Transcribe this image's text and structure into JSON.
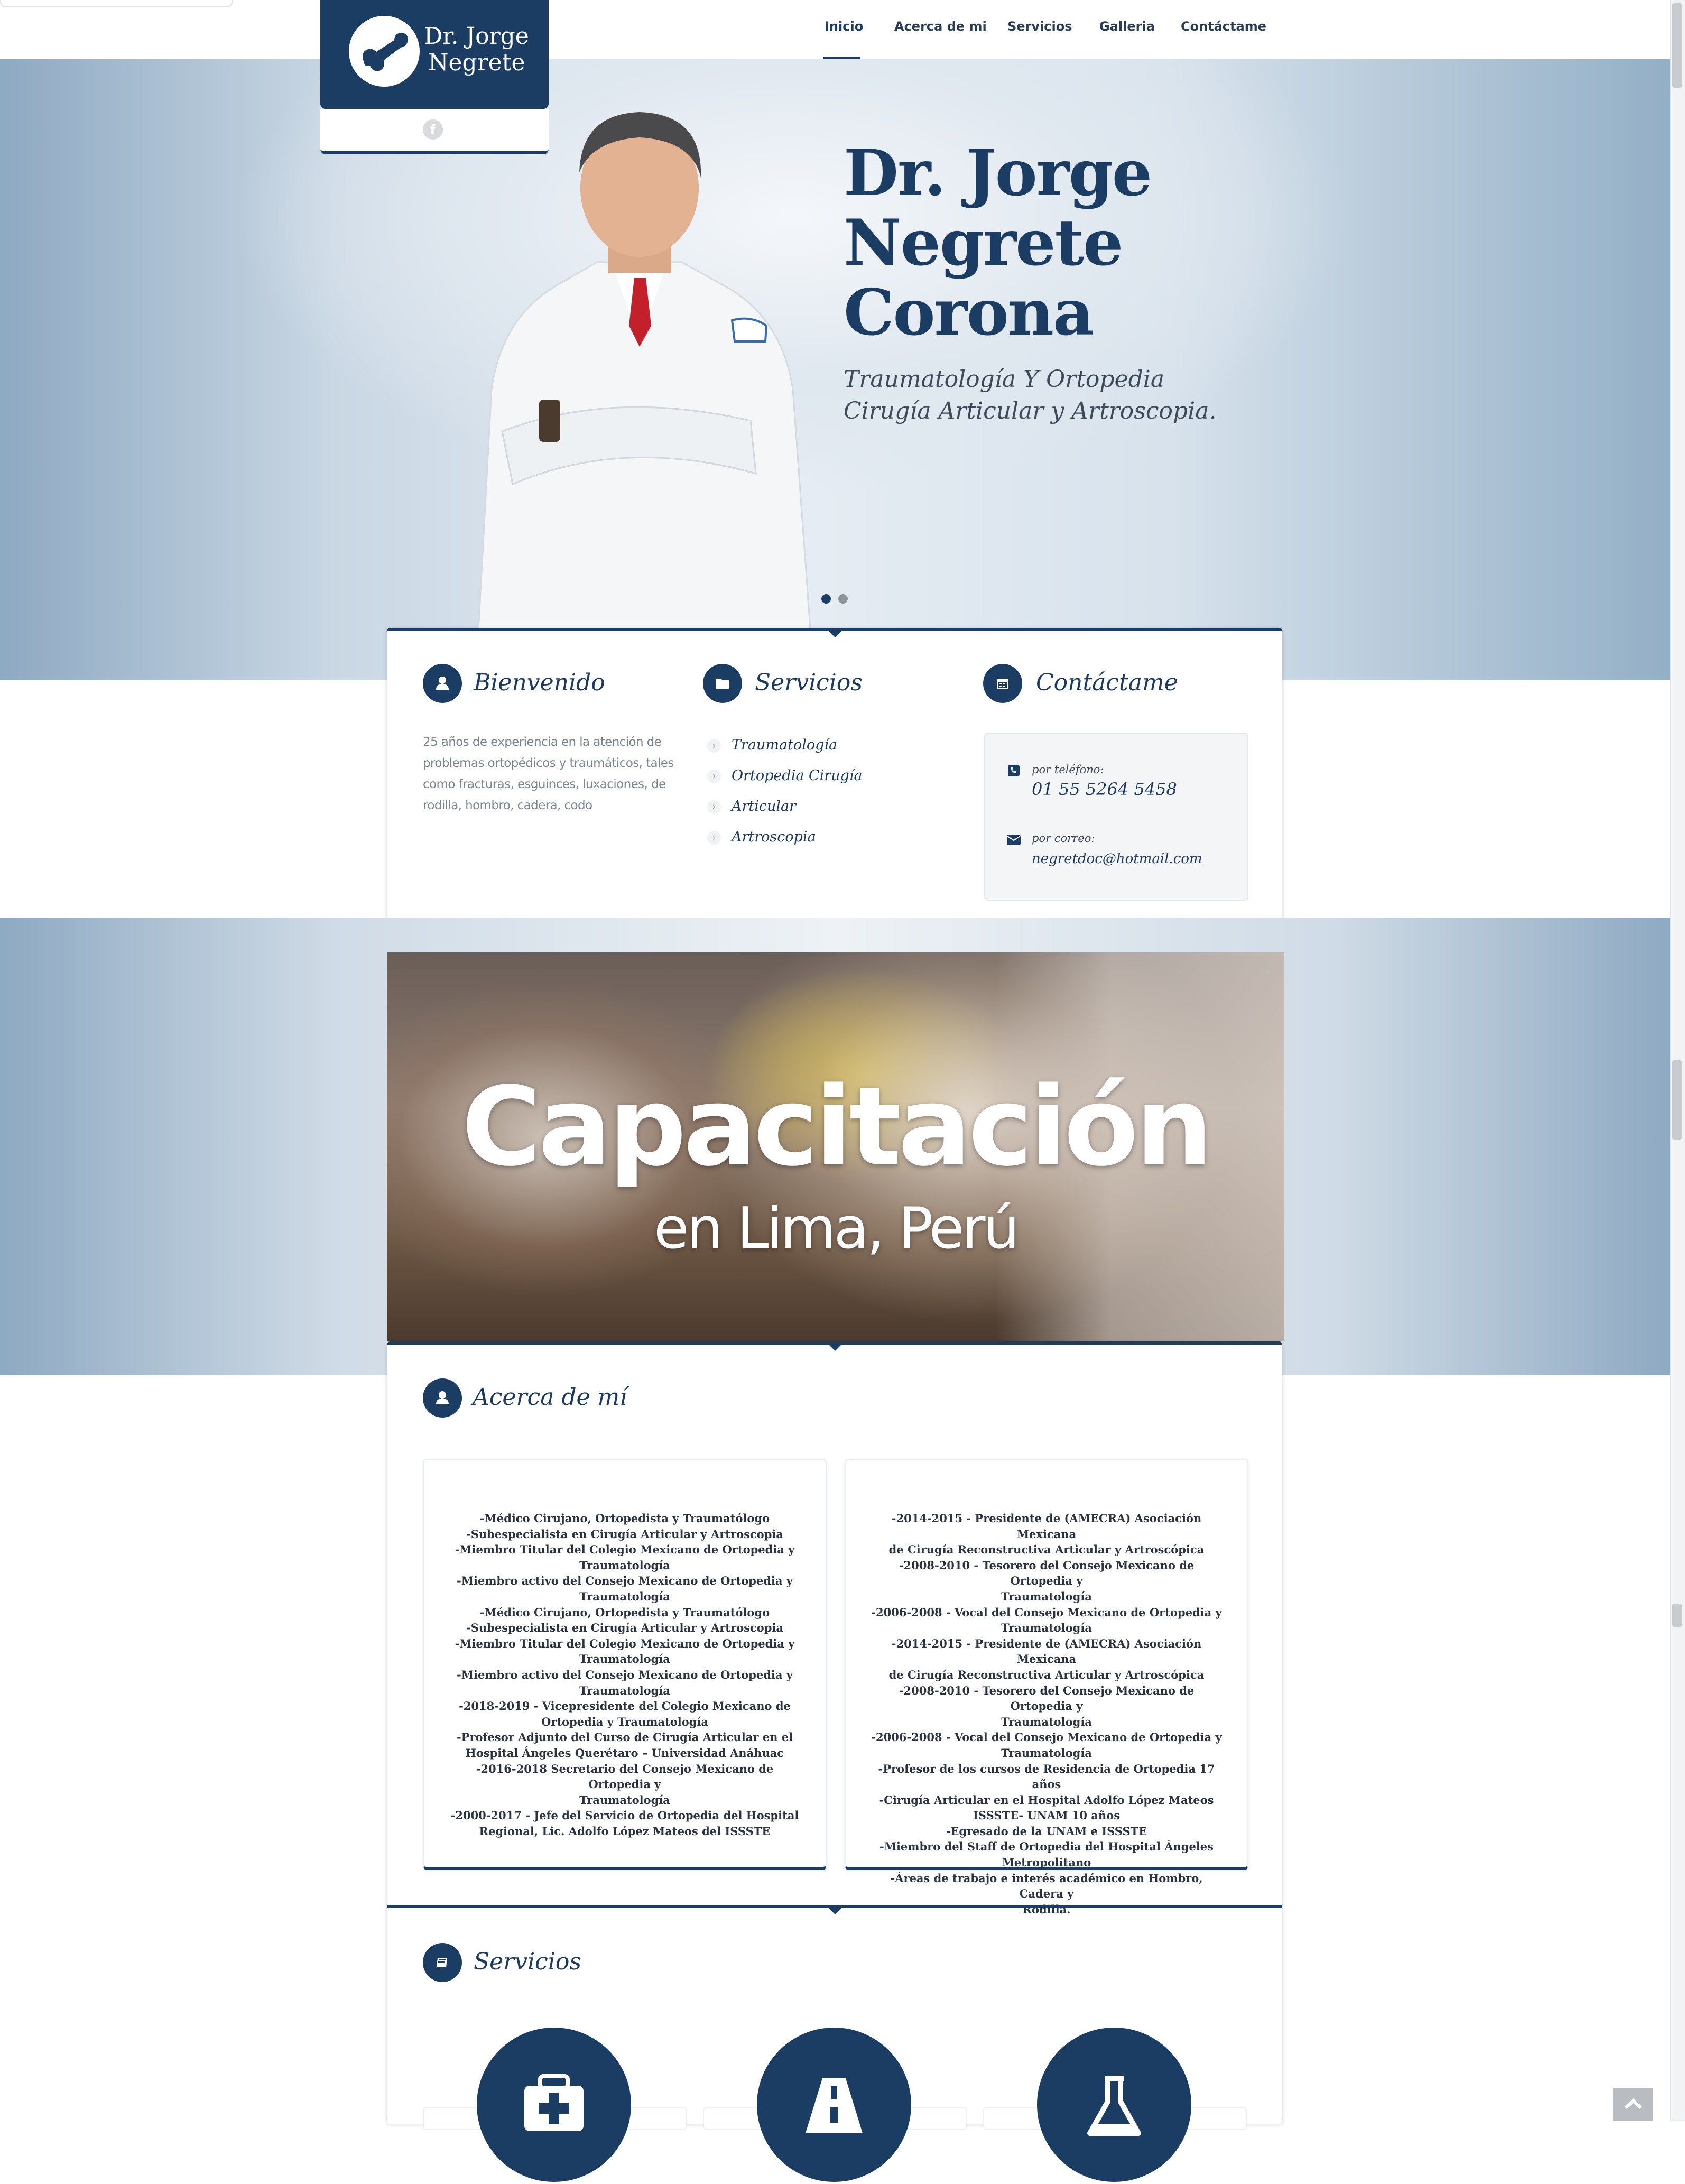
{
  "nav": {
    "items": [
      {
        "label": "Inicio",
        "active": true
      },
      {
        "label": "Acerca de mi"
      },
      {
        "label": "Servicios"
      },
      {
        "label": "Galleria"
      },
      {
        "label": "Contáctame"
      }
    ]
  },
  "logo": {
    "line1": "Dr. Jorge",
    "line2": "Negrete",
    "social_icon": "facebook-icon"
  },
  "hero": {
    "name_lines": [
      "Dr. Jorge",
      "Negrete",
      "Corona"
    ],
    "subtitle": "Traumatología Y Ortopedia Cirugía Articular y Artroscopia.",
    "slides": 2,
    "active_slide": 0
  },
  "welcome": {
    "title": "Bienvenido",
    "icon": "user-icon",
    "text": "25 años de experiencia en la atención de problemas ortopédicos y traumáticos, tales como fracturas, esguinces, luxaciones, de rodilla, hombro, cadera, codo"
  },
  "services_box": {
    "title": "Servicios",
    "icon": "folder-icon",
    "links": [
      "Traumatología",
      "Ortopedia Cirugía",
      "Articular",
      "Artroscopia"
    ]
  },
  "contact": {
    "title": "Contáctame",
    "icon": "calendar-icon",
    "phone_label": "por teléfono:",
    "phone": "01 55 5264 5458",
    "email_label": "por correo:",
    "email": "negretdoc@hotmail.com"
  },
  "banner": {
    "title": "Capacitación",
    "subtitle": "en Lima, Perú"
  },
  "about": {
    "title": "Acerca de mí",
    "icon": "user-icon",
    "left_lines": [
      "-Médico Cirujano, Ortopedista y Traumatólogo",
      "-Subespecialista en Cirugía Articular y Artroscopia",
      "-Miembro Titular del Colegio Mexicano de Ortopedia y",
      "Traumatología",
      "-Miembro activo del Consejo Mexicano de Ortopedia y",
      "Traumatología",
      "-Médico Cirujano, Ortopedista y Traumatólogo",
      "-Subespecialista en Cirugía Articular y Artroscopia",
      "-Miembro Titular del Colegio Mexicano de Ortopedia y",
      "Traumatología",
      "-Miembro activo del Consejo Mexicano de Ortopedia y",
      "Traumatología",
      "-2018-2019 - Vicepresidente del Colegio Mexicano de",
      "Ortopedia y Traumatología",
      "-Profesor Adjunto del Curso de Cirugía Articular en el",
      "Hospital Ángeles Querétaro – Universidad Anáhuac",
      "-2016-2018 Secretario del Consejo Mexicano de Ortopedia y",
      "Traumatología",
      "-2000-2017 - Jefe del Servicio de Ortopedia del Hospital",
      "Regional, Lic. Adolfo López Mateos del ISSSTE"
    ],
    "right_lines": [
      "-2014-2015 - Presidente de (AMECRA) Asociación Mexicana",
      "de Cirugía Reconstructiva Articular y Artroscópica",
      "-2008-2010 - Tesorero del Consejo Mexicano de Ortopedia y",
      "Traumatología",
      "-2006-2008 - Vocal del Consejo Mexicano de Ortopedia y",
      "Traumatología",
      "-2014-2015 - Presidente de (AMECRA) Asociación Mexicana",
      "de Cirugía Reconstructiva Articular y Artroscópica",
      "-2008-2010 - Tesorero del Consejo Mexicano de Ortopedia y",
      "Traumatología",
      "-2006-2008 - Vocal del Consejo Mexicano de Ortopedia y",
      "Traumatología",
      "-Profesor de los cursos de Residencia de Ortopedia 17 años",
      "-Cirugía Articular en el Hospital Adolfo López Mateos",
      "ISSSTE- UNAM 10 años",
      "-Egresado de la UNAM e ISSSTE",
      "-Miembro del Staff de Ortopedia del Hospital Ángeles",
      "Metropolitano",
      "-Áreas de trabajo e interés académico en Hombro, Cadera y",
      "Rodilla."
    ]
  },
  "services_section": {
    "title": "Servicios",
    "icon": "book-icon",
    "cards": [
      {
        "icon": "medical-kit-icon"
      },
      {
        "icon": "road-icon"
      },
      {
        "icon": "flask-icon"
      }
    ]
  },
  "back_to_top_icon": "chevron-up-icon",
  "colors": {
    "primary": "#1b3d64",
    "text_muted": "#7b8590",
    "background": "#ffffff"
  }
}
